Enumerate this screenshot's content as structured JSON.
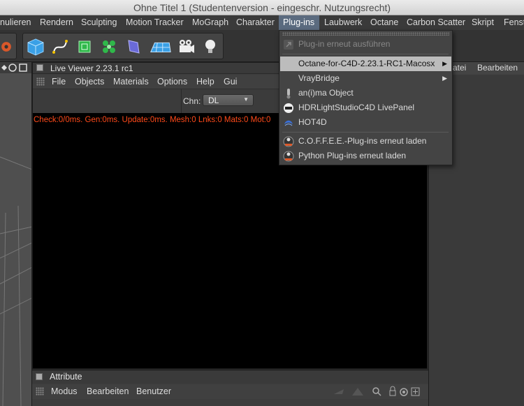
{
  "window": {
    "title": "Ohne Titel 1 (Studentenversion - eingeschr. Nutzungsrecht)"
  },
  "menubar": {
    "items": [
      {
        "label": "nulieren"
      },
      {
        "label": "Rendern"
      },
      {
        "label": "Sculpting"
      },
      {
        "label": "Motion Tracker"
      },
      {
        "label": "MoGraph"
      },
      {
        "label": "Charakter"
      },
      {
        "label": "Plug-ins",
        "active": true
      },
      {
        "label": "Laubwerk"
      },
      {
        "label": "Octane"
      },
      {
        "label": "Carbon Scatter"
      },
      {
        "label": "Skript"
      },
      {
        "label": "Fenst"
      }
    ]
  },
  "toolbar": {
    "icons": [
      "cube-icon",
      "spline-pen-icon",
      "subdivision-icon",
      "cloner-icon",
      "deformer-icon",
      "floor-icon",
      "camera-icon",
      "light-bulb-icon"
    ]
  },
  "live_viewer": {
    "title": "Live Viewer 2.23.1 rc1",
    "menu": [
      "File",
      "Objects",
      "Materials",
      "Options",
      "Help",
      "Gui"
    ],
    "channel_label": "Chn:",
    "channel_value": "DL",
    "status_text": "Check:0/0ms. Gen:0ms. Update:0ms. Mesh:0 Lnks:0 Mats:0 Mot:0"
  },
  "right_panel": {
    "items": [
      "atei",
      "Bearbeiten"
    ]
  },
  "attribute_manager": {
    "title": "Attribute",
    "menu": [
      "Modus",
      "Bearbeiten",
      "Benutzer"
    ]
  },
  "plugins_menu": {
    "items": [
      {
        "label": "Plug-in erneut ausführen",
        "icon": "plugin-rerun-icon",
        "disabled": true
      },
      {
        "label": "Octane-for-C4D-2.23.1-RC1-Macosx",
        "highlighted": true,
        "submenu": true
      },
      {
        "label": "VrayBridge",
        "submenu": true
      },
      {
        "label": "an(i)ma Object",
        "icon": "anima-icon"
      },
      {
        "label": "HDRLightStudioC4D LivePanel",
        "icon": "hdr-light-studio-icon"
      },
      {
        "label": "HOT4D",
        "icon": "hot4d-icon"
      },
      {
        "label": "C.O.F.F.E.E.-Plug-ins erneut laden",
        "icon": "coffee-reload-icon"
      },
      {
        "label": "Python Plug-ins erneut laden",
        "icon": "python-reload-icon"
      }
    ]
  },
  "colors": {
    "menu_highlight": "#bcbcbc",
    "active_menu": "#5b6b7f",
    "status_text": "#ff4a1a"
  }
}
